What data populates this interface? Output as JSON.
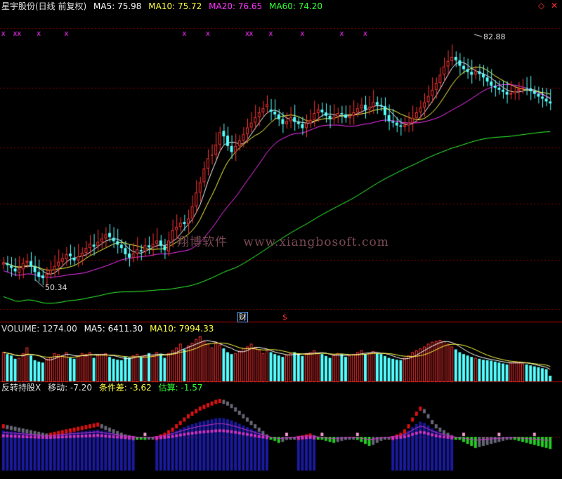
{
  "header": {
    "name": "星宇股份(日线 前复权)",
    "ma5": "MA5: 75.98",
    "ma10": "MA10: 75.72",
    "ma20": "MA20: 76.65",
    "ma60": "MA60: 74.20"
  },
  "volume_header": {
    "volume": "VOLUME: 1274.00",
    "ma5": "MA5: 6411.30",
    "ma10": "MA10: 7994.33"
  },
  "indicator_header": {
    "name": "反转持股X",
    "move": "移动: -7.20",
    "cond": "条件差: -3.62",
    "est": "估算: -1.57"
  },
  "controls": {
    "diamond": "◇",
    "close": "✕"
  },
  "tags": {
    "cai": "财",
    "s": "$"
  },
  "watermark": {
    "cn": "翔博软件",
    "url": "www.xiangbosoft.com"
  },
  "price_labels": {
    "high": "82.88",
    "low": "50.34"
  },
  "colors": {
    "up": "#ff3333",
    "down": "#54ffff",
    "ma5": "#ffffff",
    "ma10": "#ffff44",
    "ma20": "#ff33ff",
    "ma60": "#33ff33",
    "grid": "#8b0000",
    "separator": "#b00000",
    "marker": "#ff33ff",
    "ind_blue": "#1a1aa0",
    "ind_magenta": "#cc33cc",
    "ind_green": "#22cc22",
    "ind_red": "#dd1111",
    "ind_gray": "#666677",
    "ind_pink": "#ee99cc"
  },
  "chart_data": {
    "type": "candlestick",
    "n_bars": 140,
    "price_range": [
      46,
      87
    ],
    "marker_label": "x",
    "marker_bars": [
      0,
      3,
      4,
      9,
      16,
      46,
      52,
      62,
      63,
      68,
      76,
      86,
      92
    ],
    "close": [
      52.8,
      52.4,
      52.0,
      51.5,
      51.9,
      52.7,
      53.0,
      52.2,
      51.4,
      50.7,
      50.5,
      51.1,
      51.7,
      52.3,
      52.9,
      53.4,
      54.0,
      53.7,
      53.1,
      53.7,
      54.2,
      54.9,
      55.5,
      55.1,
      55.8,
      56.3,
      56.9,
      56.5,
      55.9,
      55.4,
      54.9,
      54.0,
      53.5,
      54.1,
      54.7,
      54.4,
      55.3,
      55.0,
      55.5,
      56.0,
      55.2,
      54.6,
      56.0,
      57.5,
      58.0,
      58.6,
      58.4,
      59.2,
      61.0,
      63.0,
      64.5,
      66.5,
      68.0,
      68.5,
      70.0,
      71.8,
      71.2,
      69.8,
      68.9,
      69.8,
      70.6,
      71.5,
      72.5,
      73.2,
      74.0,
      74.7,
      75.3,
      75.9,
      74.8,
      74.4,
      73.7,
      73.0,
      73.4,
      74.0,
      73.3,
      73.0,
      72.4,
      73.1,
      73.6,
      74.6,
      75.1,
      74.7,
      74.2,
      73.7,
      74.1,
      74.6,
      74.4,
      73.9,
      74.2,
      74.7,
      75.3,
      75.8,
      75.1,
      75.5,
      76.2,
      75.8,
      75.6,
      74.3,
      73.4,
      73.2,
      72.8,
      72.6,
      72.8,
      73.2,
      73.9,
      74.7,
      75.4,
      76.2,
      77.1,
      78.0,
      79.0,
      80.2,
      81.4,
      82.2,
      82.8,
      82.3,
      81.5,
      81.0,
      80.6,
      80.2,
      80.7,
      80.3,
      79.8,
      79.2,
      78.6,
      78.3,
      78.0,
      77.7,
      77.3,
      77.5,
      77.8,
      78.1,
      78.3,
      78.2,
      77.8,
      77.4,
      77.0,
      76.7,
      76.3,
      76.0
    ],
    "open": [
      52.5,
      52.7,
      52.3,
      51.9,
      51.3,
      51.8,
      52.7,
      53.0,
      52.2,
      51.4,
      50.9,
      50.6,
      51.1,
      51.7,
      52.3,
      52.9,
      53.3,
      54.1,
      53.5,
      53.1,
      53.7,
      54.2,
      54.9,
      55.4,
      55.2,
      55.8,
      56.3,
      57.1,
      56.4,
      55.9,
      55.4,
      54.9,
      54.1,
      53.5,
      54.1,
      54.6,
      54.4,
      55.3,
      55.0,
      55.5,
      56.0,
      55.2,
      54.4,
      56.0,
      57.5,
      58.0,
      58.7,
      58.4,
      59.2,
      61.0,
      63.0,
      64.5,
      66.5,
      68.4,
      68.5,
      70.0,
      72.0,
      71.3,
      69.8,
      68.9,
      69.8,
      70.6,
      71.5,
      72.5,
      73.2,
      74.0,
      74.7,
      75.5,
      75.1,
      74.8,
      74.4,
      73.7,
      73.0,
      73.4,
      74.0,
      73.3,
      73.0,
      72.4,
      73.1,
      73.6,
      74.6,
      75.1,
      74.7,
      74.2,
      73.7,
      74.1,
      74.6,
      74.4,
      73.9,
      74.2,
      74.7,
      75.3,
      75.8,
      75.1,
      75.5,
      76.2,
      75.8,
      75.6,
      74.3,
      73.4,
      73.2,
      72.8,
      72.6,
      72.8,
      73.2,
      73.9,
      74.7,
      75.4,
      76.2,
      77.1,
      78.0,
      79.0,
      80.2,
      81.4,
      82.2,
      82.8,
      82.3,
      81.5,
      81.0,
      80.6,
      80.2,
      80.7,
      80.3,
      79.8,
      79.2,
      78.6,
      78.3,
      78.0,
      77.7,
      77.3,
      77.5,
      77.8,
      78.1,
      78.3,
      78.2,
      77.8,
      77.4,
      77.0,
      76.7,
      76.3
    ],
    "ma_labels": [
      "MA5",
      "MA10",
      "MA20",
      "MA60"
    ],
    "volume": [
      62,
      58,
      55,
      48,
      50,
      60,
      72,
      55,
      45,
      42,
      40,
      48,
      52,
      60,
      58,
      55,
      62,
      50,
      48,
      55,
      60,
      58,
      62,
      50,
      56,
      58,
      60,
      52,
      48,
      46,
      45,
      52,
      50,
      55,
      58,
      52,
      56,
      60,
      55,
      62,
      58,
      50,
      60,
      66,
      72,
      80,
      68,
      76,
      82,
      90,
      96,
      86,
      80,
      72,
      84,
      78,
      70,
      62,
      58,
      60,
      65,
      70,
      74,
      80,
      72,
      66,
      60,
      66,
      62,
      58,
      55,
      52,
      56,
      60,
      62,
      58,
      54,
      60,
      62,
      66,
      60,
      58,
      54,
      50,
      56,
      60,
      58,
      52,
      55,
      58,
      62,
      66,
      58,
      60,
      64,
      60,
      58,
      54,
      50,
      48,
      46,
      45,
      50,
      55,
      62,
      66,
      70,
      74,
      80,
      84,
      86,
      88,
      85,
      80,
      74,
      68,
      62,
      58,
      55,
      52,
      50,
      48,
      46,
      45,
      44,
      42,
      40,
      38,
      36,
      40,
      42,
      40,
      38,
      36,
      34,
      32,
      30,
      28,
      26,
      12
    ],
    "indicator": [
      30,
      28,
      26,
      24,
      22,
      20,
      18,
      16,
      14,
      12,
      10,
      8,
      10,
      12,
      14,
      16,
      18,
      20,
      22,
      24,
      26,
      28,
      30,
      32,
      34,
      30,
      26,
      22,
      18,
      14,
      10,
      6,
      4,
      2,
      -2,
      -4,
      -6,
      -4,
      -2,
      2,
      6,
      10,
      16,
      22,
      30,
      38,
      46,
      54,
      60,
      66,
      72,
      76,
      80,
      84,
      88,
      90,
      88,
      84,
      78,
      70,
      62,
      54,
      46,
      38,
      30,
      22,
      14,
      6,
      -2,
      -8,
      -12,
      -10,
      -6,
      -4,
      -2,
      2,
      4,
      6,
      8,
      4,
      0,
      -4,
      -8,
      -10,
      -12,
      -10,
      -8,
      -6,
      -4,
      -2,
      -6,
      -10,
      -14,
      -18,
      -16,
      -12,
      -8,
      -4,
      -2,
      2,
      6,
      10,
      18,
      30,
      46,
      60,
      72,
      66,
      54,
      40,
      30,
      22,
      16,
      10,
      4,
      -2,
      -6,
      -10,
      -14,
      -18,
      -22,
      -20,
      -18,
      -16,
      -14,
      -12,
      -10,
      -8,
      -6,
      -4,
      -6,
      -8,
      -10,
      -12,
      -14,
      -16,
      -18,
      -20,
      -22,
      -24
    ]
  }
}
